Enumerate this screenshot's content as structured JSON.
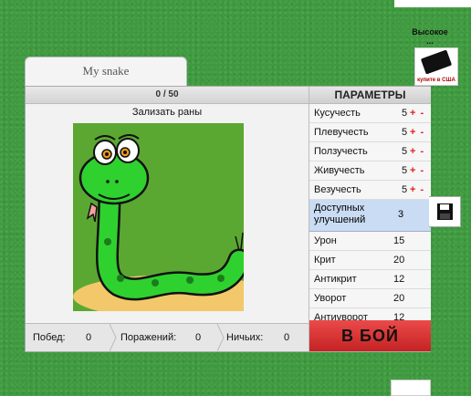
{
  "side": {
    "title": "Высокое ...",
    "ad_caption": "купите в США"
  },
  "tab": {
    "label": "My snake"
  },
  "progress": {
    "text": "0 / 50"
  },
  "status": {
    "text": "Зализать раны"
  },
  "params": {
    "title": "ПАРАМЕТРЫ",
    "upgradeable": [
      {
        "label": "Кусучесть",
        "value": "5",
        "controls": "+ -"
      },
      {
        "label": "Плевучесть",
        "value": "5",
        "controls": "+ -"
      },
      {
        "label": "Ползучесть",
        "value": "5",
        "controls": "+ -"
      },
      {
        "label": "Живучесть",
        "value": "5",
        "controls": "+ -"
      },
      {
        "label": "Везучесть",
        "value": "5",
        "controls": "+ -"
      }
    ],
    "available_label": "Доступных улучшений",
    "available_value": "3",
    "stats": [
      {
        "label": "Урон",
        "value": "15"
      },
      {
        "label": "Крит",
        "value": "20"
      },
      {
        "label": "Антикрит",
        "value": "12"
      },
      {
        "label": "Уворот",
        "value": "20"
      },
      {
        "label": "Антиуворот",
        "value": "12"
      }
    ],
    "battle_label": "В БОЙ"
  },
  "footer": {
    "wins_label": "Побед:",
    "wins": "0",
    "losses_label": "Поражений:",
    "losses": "0",
    "draws_label": "Ничьих:",
    "draws": "0"
  },
  "colors": {
    "accent": "#e02020",
    "battle": "#d83434",
    "highlight": "#c9dcf3",
    "snake": "#2fd12f"
  }
}
